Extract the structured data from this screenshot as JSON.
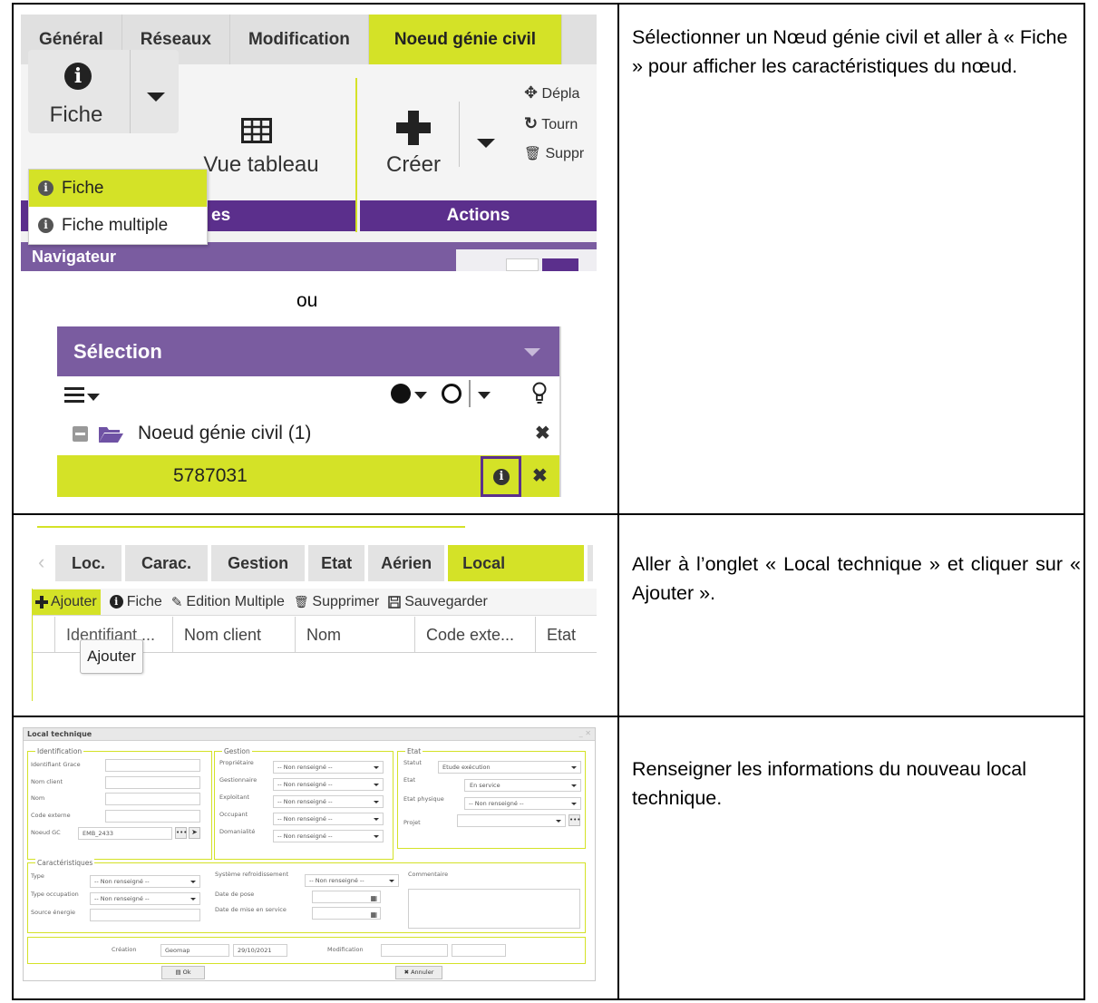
{
  "descriptions": {
    "row1": "Sélectionner un Nœud génie civil et aller à « Fiche » pour afficher les caractéristiques du nœud.",
    "row2": "Aller à l’onglet « Local technique » et cliquer sur « Ajouter ».",
    "row3": "Renseigner les informations du nouveau local technique."
  },
  "separator_text": "ou",
  "ribbon": {
    "tabs": [
      "Général",
      "Réseaux",
      "Modification",
      "Noeud génie civil"
    ],
    "fiche_label": "Fiche",
    "vue_tableau_label": "Vue tableau",
    "creer_label": "Créer",
    "side_actions": [
      "Dépla",
      "Tourn",
      "Suppr"
    ],
    "group_left_partial": "es",
    "group_actions": "Actions",
    "dropdown_items": [
      "Fiche",
      "Fiche multiple"
    ],
    "navigator_label": "Navigateur"
  },
  "selection_panel": {
    "title": "Sélection",
    "group_label": "Noeud génie civil (1)",
    "item_id": "5787031"
  },
  "tabs_panel": {
    "tabs": [
      "Loc.",
      "Carac.",
      "Gestion",
      "Etat",
      "Aérien",
      "Local technique"
    ],
    "toolbar": [
      "Ajouter",
      "Fiche",
      "Edition Multiple",
      "Supprimer",
      "Sauvegarder"
    ],
    "columns": [
      "Identifiant ...",
      "Nom client",
      "Nom",
      "Code exte...",
      "Etat"
    ],
    "tooltip": "Ajouter"
  },
  "form": {
    "title": "Local technique",
    "identification": {
      "legend": "Identification",
      "labels": [
        "Identifiant Grace",
        "Nom client",
        "Nom",
        "Code externe",
        "Noeud GC"
      ],
      "noeud_gc_value": "EMB_2433"
    },
    "gestion": {
      "legend": "Gestion",
      "labels": [
        "Propriétaire",
        "Gestionnaire",
        "Exploitant",
        "Occupant",
        "Domanialité"
      ],
      "default_value": "-- Non renseigné --"
    },
    "etat": {
      "legend": "Etat",
      "labels": [
        "Statut",
        "Etat",
        "Etat physique",
        "Projet"
      ],
      "values": [
        "Etude exécution",
        "En service",
        "-- Non renseigné --",
        ""
      ]
    },
    "caracteristiques": {
      "legend": "Caractéristiques",
      "labels_left": [
        "Type",
        "Type occupation",
        "Source énergie"
      ],
      "values_left": [
        "-- Non renseigné --",
        "-- Non renseigné --",
        ""
      ],
      "labels_mid": [
        "Système refroidissement",
        "Date de pose",
        "Date de mise en service"
      ],
      "values_mid": [
        "-- Non renseigné --",
        "",
        ""
      ],
      "commentaire_label": "Commentaire"
    },
    "footer": {
      "creation_label": "Création",
      "creation_user": "Geomap",
      "creation_date": "29/10/2021",
      "modification_label": "Modification"
    },
    "ok_label": "Ok",
    "annuler_label": "Annuler"
  }
}
